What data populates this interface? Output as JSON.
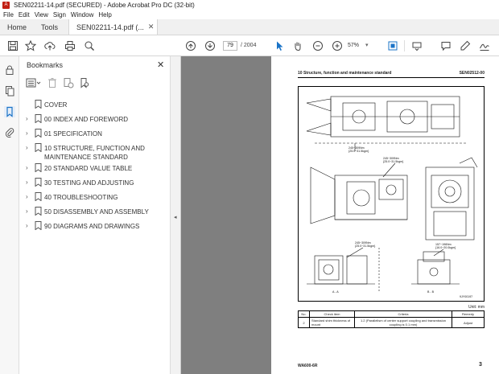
{
  "window": {
    "title": "SEN02211-14.pdf (SECURED) - Adobe Acrobat Pro DC (32-bit)"
  },
  "menu": [
    "File",
    "Edit",
    "View",
    "Sign",
    "Window",
    "Help"
  ],
  "tabs": {
    "home": "Home",
    "tools": "Tools",
    "doc": "SEN02211-14.pdf (..."
  },
  "toolbar": {
    "page_current": "79",
    "page_total": "/ 2004",
    "zoom": "57%"
  },
  "bookmarks": {
    "title": "Bookmarks",
    "items": [
      {
        "label": "COVER",
        "expandable": false
      },
      {
        "label": "00 INDEX AND FOREWORD",
        "expandable": true
      },
      {
        "label": "01 SPECIFICATION",
        "expandable": true
      },
      {
        "label": "10 STRUCTURE, FUNCTION AND MAINTENANCE STANDARD",
        "expandable": true
      },
      {
        "label": "20 STANDARD VALUE TABLE",
        "expandable": true
      },
      {
        "label": "30 TESTING AND ADJUSTING",
        "expandable": true
      },
      {
        "label": "40 TROUBLESHOOTING",
        "expandable": true
      },
      {
        "label": "50 DISASSEMBLY AND ASSEMBLY",
        "expandable": true
      },
      {
        "label": "90 DIAGRAMS AND DRAWINGS",
        "expandable": true
      }
    ]
  },
  "page": {
    "header_left": "10 Structure, function and maintenance standard",
    "header_right": "SEN02512-00",
    "torque1": "245~309Nm",
    "torque1b": "{25.0~31.5kgm}",
    "torque2": "245~309Nm",
    "torque2b": "{25.0~31.5kgm}",
    "torque3": "245~309Nm",
    "torque3b": "{25.0~31.5kgm}",
    "torque4": "157~196Nm",
    "torque4b": "{16.0~20.0kgm}",
    "section_aa": "A - A",
    "section_bb": "B - B",
    "fig_code": "9JY00197",
    "unit": "Unit: mm",
    "table_headers": [
      "No.",
      "Check item",
      "Criteria",
      "Remedy"
    ],
    "table_row": [
      "2",
      "Standard shim thickness of mount",
      "1.2 (Parallelism of center support coupling and transmission coupling is 0.1 mm)",
      "Adjust"
    ],
    "footer_left": "WA600-6R",
    "footer_right": "3"
  },
  "colors": {
    "accent": "#1a73c7",
    "viewer_bg": "#7f7f7f"
  }
}
